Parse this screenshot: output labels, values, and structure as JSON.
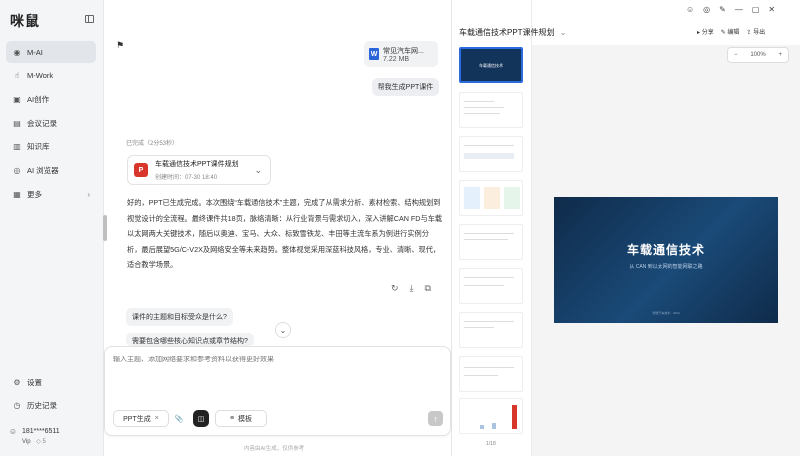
{
  "app": {
    "logo": "咪鼠"
  },
  "sidebar": {
    "items": [
      {
        "label": "M-AI",
        "icon": "mai-icon"
      },
      {
        "label": "M-Work",
        "icon": "hand-icon"
      },
      {
        "label": "AI创作",
        "icon": "image-icon"
      },
      {
        "label": "会议记录",
        "icon": "note-icon"
      },
      {
        "label": "知识库",
        "icon": "book-icon"
      },
      {
        "label": "AI 浏览器",
        "icon": "browser-icon"
      },
      {
        "label": "更多",
        "icon": "grid-icon"
      }
    ],
    "bottom": [
      {
        "label": "设置",
        "icon": "gear-icon"
      },
      {
        "label": "历史记录",
        "icon": "history-icon"
      }
    ],
    "user": {
      "phone": "181****6511",
      "vip": "Vip",
      "credits": "5"
    }
  },
  "chat": {
    "file": {
      "name": "常见汽车网...",
      "size": "7.22 MB"
    },
    "user_message": "帮我生成PPT课件",
    "done_text": "已完成（2分53秒）",
    "doc": {
      "title": "车载通信技术PPT课件规划",
      "time": "创建时间：07-30 18:40"
    },
    "answer": "好的，PPT已生成完成。本次围绕“车载通信技术”主题，完成了从需求分析、素材检索、结构规划到视觉设计的全流程。最终课件共18页，脉络清晰：从行业背景与需求切入，深入讲解CAN FD与车载以太网两大关键技术，随后以奥迪、宝马、大众、标致雪铁龙、丰田等主流车系为例进行实例分析，最后展望5G/C-V2X及网络安全等未来趋势。整体视觉采用深蓝科技风格，专业、清晰、现代，适合教学场景。",
    "suggestions": [
      "课件的主题和目标受众是什么?",
      "需要包含哪些核心知识点或章节结构?"
    ],
    "input_placeholder": "输入主题、添加网络要求和参考资料以获得更好效果",
    "chip_ppt": "PPT生成",
    "chip_template": "模板",
    "footer": "内容由AI生成，仅供参考"
  },
  "preview": {
    "title": "车载通信技术PPT课件规划",
    "actions": [
      "分享",
      "编辑",
      "导出"
    ],
    "zoom": "100%",
    "slide": {
      "title": "车载通信技术",
      "subtitle": "从 CAN 到以太网的智能网联之路",
      "footer": "智能汽车技术 · 2024"
    },
    "page_count": "1/18"
  }
}
